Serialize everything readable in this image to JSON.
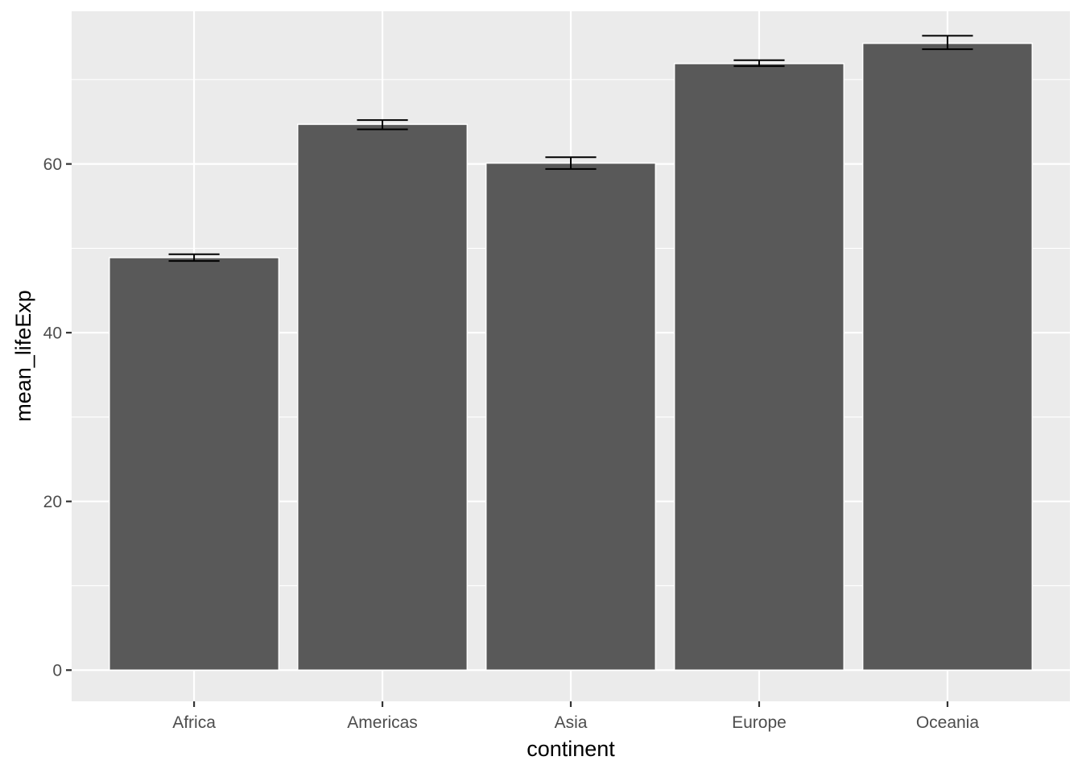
{
  "chart_data": {
    "type": "bar",
    "title": "",
    "xlabel": "continent",
    "ylabel": "mean_lifeExp",
    "categories": [
      "Africa",
      "Americas",
      "Asia",
      "Europe",
      "Oceania"
    ],
    "values": [
      48.9,
      64.7,
      60.1,
      71.9,
      74.3
    ],
    "error_bars": {
      "lower": [
        48.5,
        64.1,
        59.4,
        71.6,
        73.6
      ],
      "upper": [
        49.3,
        65.2,
        60.8,
        72.3,
        75.2
      ]
    },
    "ylim": [
      -3.7,
      78.1
    ],
    "yticks": [
      0,
      20,
      40,
      60
    ],
    "ytick_labels": [
      "0",
      "20",
      "40",
      "60"
    ],
    "y_minor_gridlines": [
      10,
      30,
      50,
      70
    ],
    "grid": true,
    "legend": "none",
    "colors": {
      "bar_fill": "#595959",
      "bar_outline": "#ffffff",
      "panel_background": "#ebebeb",
      "grid": "#ffffff",
      "error_bar": "#000000"
    }
  }
}
